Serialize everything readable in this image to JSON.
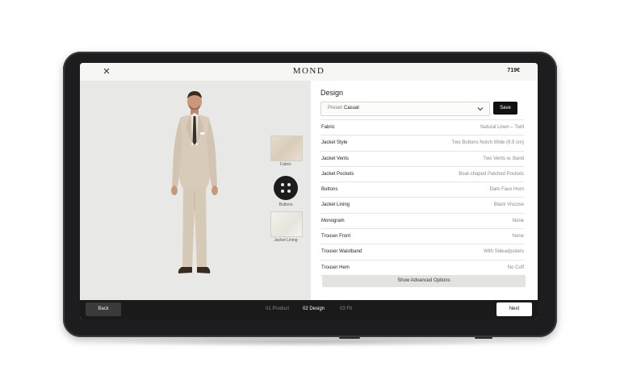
{
  "header": {
    "brand": "MOND",
    "price": "719€"
  },
  "preview": {
    "swatches": [
      {
        "label": "Fabric"
      },
      {
        "label": "Buttons"
      },
      {
        "label": "Jacket Lining"
      }
    ]
  },
  "panel": {
    "title": "Design",
    "preset": {
      "label": "Preset:",
      "value": "Casual"
    },
    "save_label": "Save",
    "options": [
      {
        "label": "Fabric",
        "value": "Natural Linen – Twill"
      },
      {
        "label": "Jacket Style",
        "value": "Two Buttons Notch Wide (9.5 cm)"
      },
      {
        "label": "Jacket Vents",
        "value": "Two Vents w. Band"
      },
      {
        "label": "Jacket Pockets",
        "value": "Boat-shaped Patched Pockets"
      },
      {
        "label": "Buttons",
        "value": "Dark Faux Horn"
      },
      {
        "label": "Jacket Lining",
        "value": "Black Viscose"
      },
      {
        "label": "Monogram",
        "value": "None"
      },
      {
        "label": "Trouser Front",
        "value": "None"
      },
      {
        "label": "Trouser Waistband",
        "value": "With Sideadjusters"
      },
      {
        "label": "Trouser Hem",
        "value": "No Cuff"
      }
    ],
    "advanced_label": "Show Advanced Options"
  },
  "footer": {
    "back_label": "Back",
    "steps": [
      {
        "label": "01 Product"
      },
      {
        "label": "02 Design"
      },
      {
        "label": "03 Fit"
      }
    ],
    "next_label": "Next"
  },
  "colors": {
    "accent": "#111111",
    "bottombar": "#1a1a1a",
    "preview_bg": "#e8e8e6"
  },
  "icons": [
    "close-icon",
    "chevron-down-icon"
  ]
}
